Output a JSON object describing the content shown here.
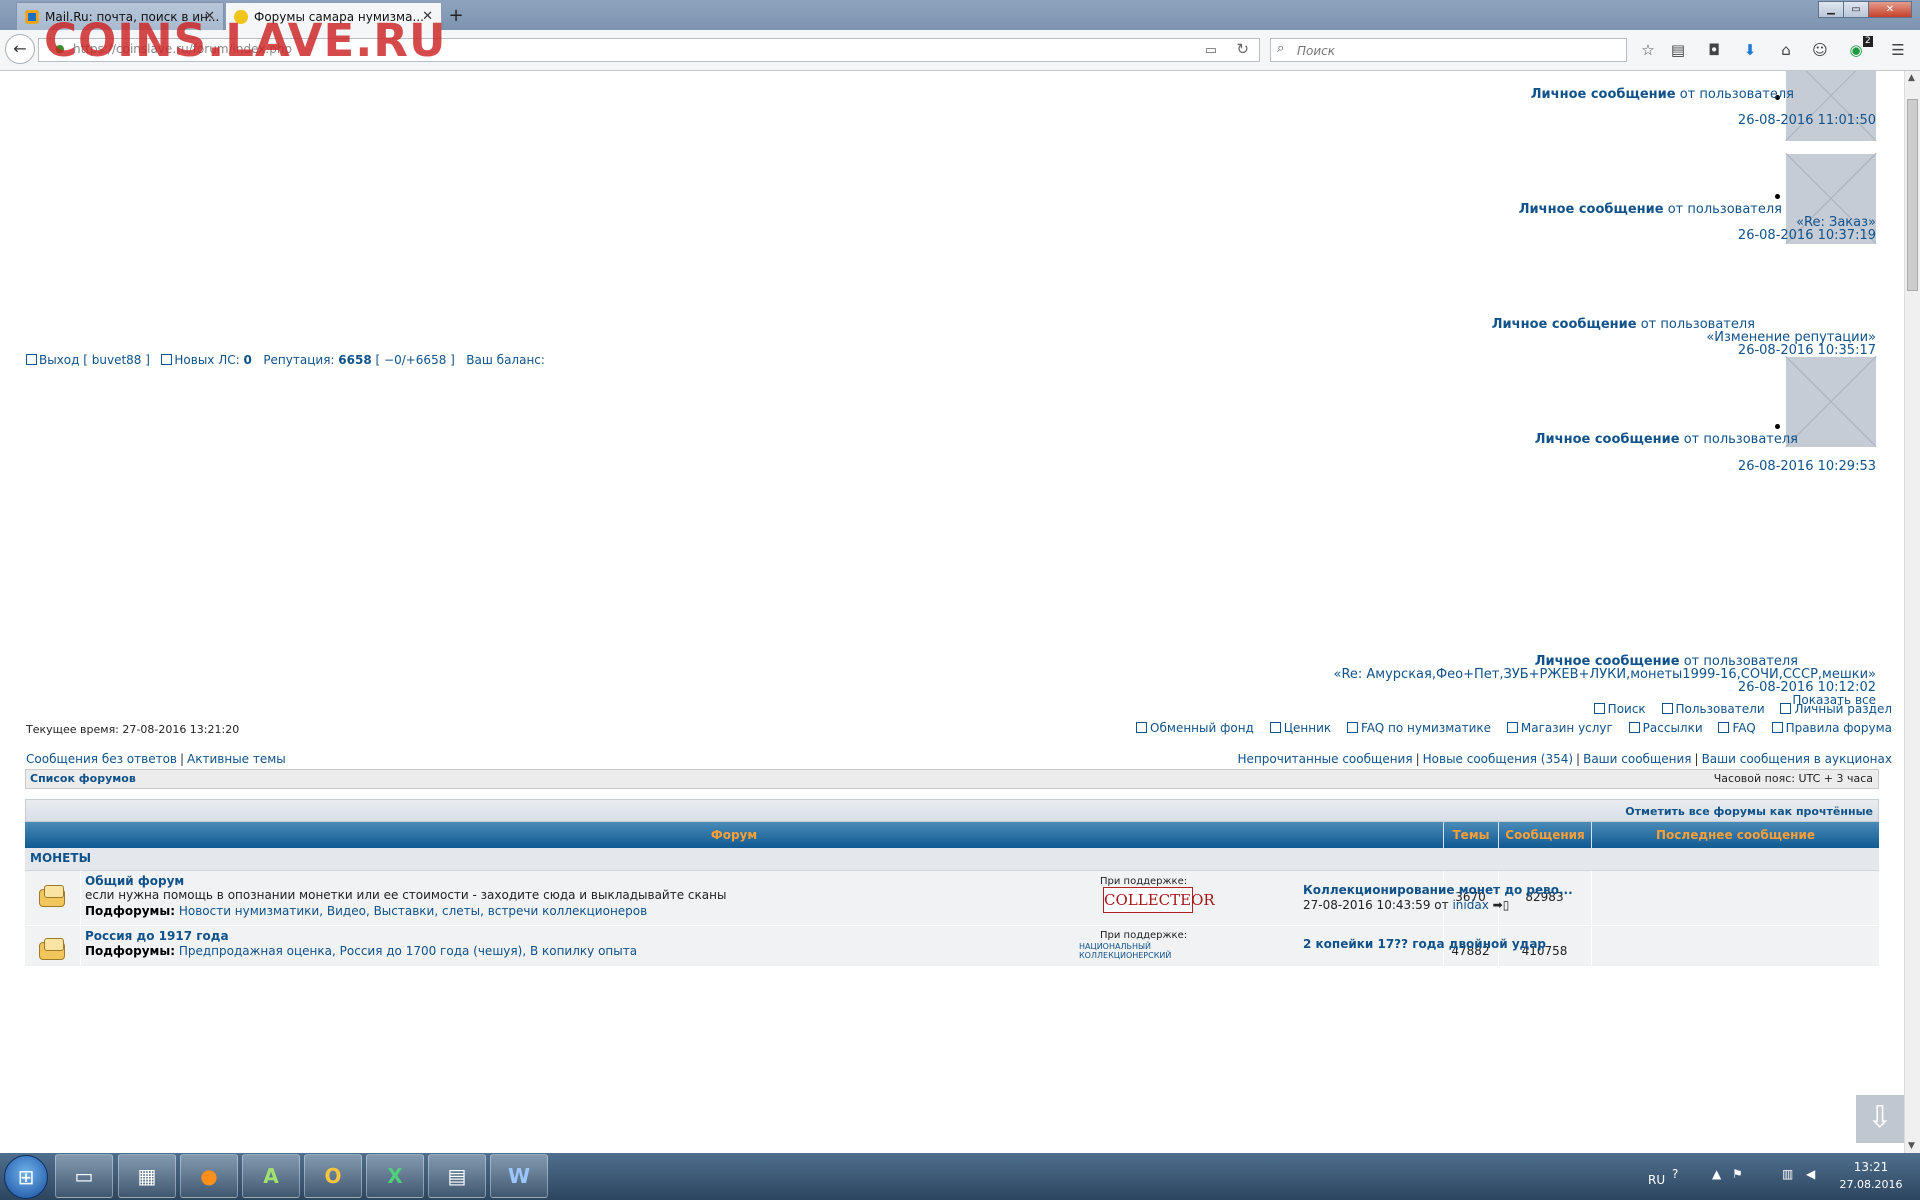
{
  "browser": {
    "tabs": [
      {
        "title": "Mail.Ru: почта, поиск в ин...",
        "active": false
      },
      {
        "title": "Форумы самара нумизма...",
        "active": true
      }
    ],
    "new_tab": "+",
    "url": "https://coinslave.ru/forum/index.php",
    "watermark": "COINS.LAVE.RU",
    "search_placeholder": "Поиск",
    "notification_count": "2",
    "window_buttons": {
      "minimize": "▁",
      "maximize": "▭",
      "close": "✕"
    }
  },
  "private_messages": [
    {
      "label": "Личное сообщение",
      "from_text": "от пользователя",
      "subject": "",
      "date": "26-08-2016 11:01:50"
    },
    {
      "label": "Личное сообщение",
      "from_text": "от пользователя",
      "subject": "«Re: Заказ»",
      "date": "26-08-2016 10:37:19"
    },
    {
      "label": "Личное сообщение",
      "from_text": "от пользователя",
      "subject": "«Изменение репутации»",
      "date": "26-08-2016 10:35:17"
    },
    {
      "label": "Личное сообщение",
      "from_text": "от пользователя",
      "subject": "",
      "date": "26-08-2016 10:29:53"
    },
    {
      "label": "Личное сообщение",
      "from_text": "от пользователя",
      "subject": "«Re: Амурская,Фео+Пет,ЗУБ+РЖЕВ+ЛУКИ,монеты1999-16,СОЧИ,СССР,мешки»",
      "date": "26-08-2016 10:12:02"
    }
  ],
  "show_all": "Показать все",
  "user_bar": {
    "logout": "Выход [ buvet88 ]",
    "new_pm_label": "Новых ЛС:",
    "new_pm_count": "0",
    "reputation_label": "Репутация:",
    "reputation_value": "6658",
    "reputation_detail": "[ −0/+6658 ]",
    "balance_label": "Ваш баланс:"
  },
  "current_time": "Текущее время: 27-08-2016 13:21:20",
  "quick_links_top": [
    "Поиск",
    "Пользователи",
    "Личный раздел"
  ],
  "quick_links": [
    "Обменный фонд",
    "Ценник",
    "FAQ по нумизматике",
    "Магазин услуг",
    "Рассылки",
    "FAQ",
    "Правила форума"
  ],
  "search_links_left": [
    "Сообщения без ответов",
    "Активные темы"
  ],
  "search_links_right": [
    "Непрочитанные сообщения",
    "Новые сообщения (354)",
    "Ваши сообщения",
    "Ваши сообщения в аукционах"
  ],
  "breadcrumb": "Список форумов",
  "timezone": "Часовой пояс: UTC + 3 часа",
  "mark_all_read": "Отметить все форумы как прочтённые",
  "table_headers": {
    "forum": "Форум",
    "topics": "Темы",
    "posts": "Сообщения",
    "last_post": "Последнее сообщение"
  },
  "category": "МОНЕТЫ",
  "forums": [
    {
      "title": "Общий форум",
      "description": "если нужна помощь в опознании монетки или ее стоимости - заходите сюда и выкладывайте сканы",
      "subforums_label": "Подфорумы:",
      "subforums": [
        "Новости нумизматики",
        "Видео",
        "Выставки, слеты, встречи коллекционеров"
      ],
      "sponsor_label": "При поддержке:",
      "sponsor_name": "COLLECTEOR",
      "topics": "3670",
      "posts": "82983",
      "last_post_title": "Коллекционирование монет до рево...",
      "last_post_date": "27-08-2016 10:43:59",
      "last_post_by": "от",
      "last_post_user": "inidax"
    },
    {
      "title": "Россия до 1917 года",
      "description": "",
      "subforums_label": "Подфорумы:",
      "subforums": [
        "Предпродажная оценка",
        "Россия до 1700 года (чешуя)",
        "В копилку опыта"
      ],
      "sponsor_label": "При поддержке:",
      "sponsor_name": "НАЦИОНАЛЬНЫЙ КОЛЛЕКЦИОНЕРСКИЙ",
      "topics": "47882",
      "posts": "410758",
      "last_post_title": "2 копейки 17?? года двойной удар",
      "last_post_date": "",
      "last_post_by": "",
      "last_post_user": ""
    }
  ],
  "taskbar": {
    "language": "RU",
    "time": "13:21",
    "date": "27.08.2016"
  }
}
